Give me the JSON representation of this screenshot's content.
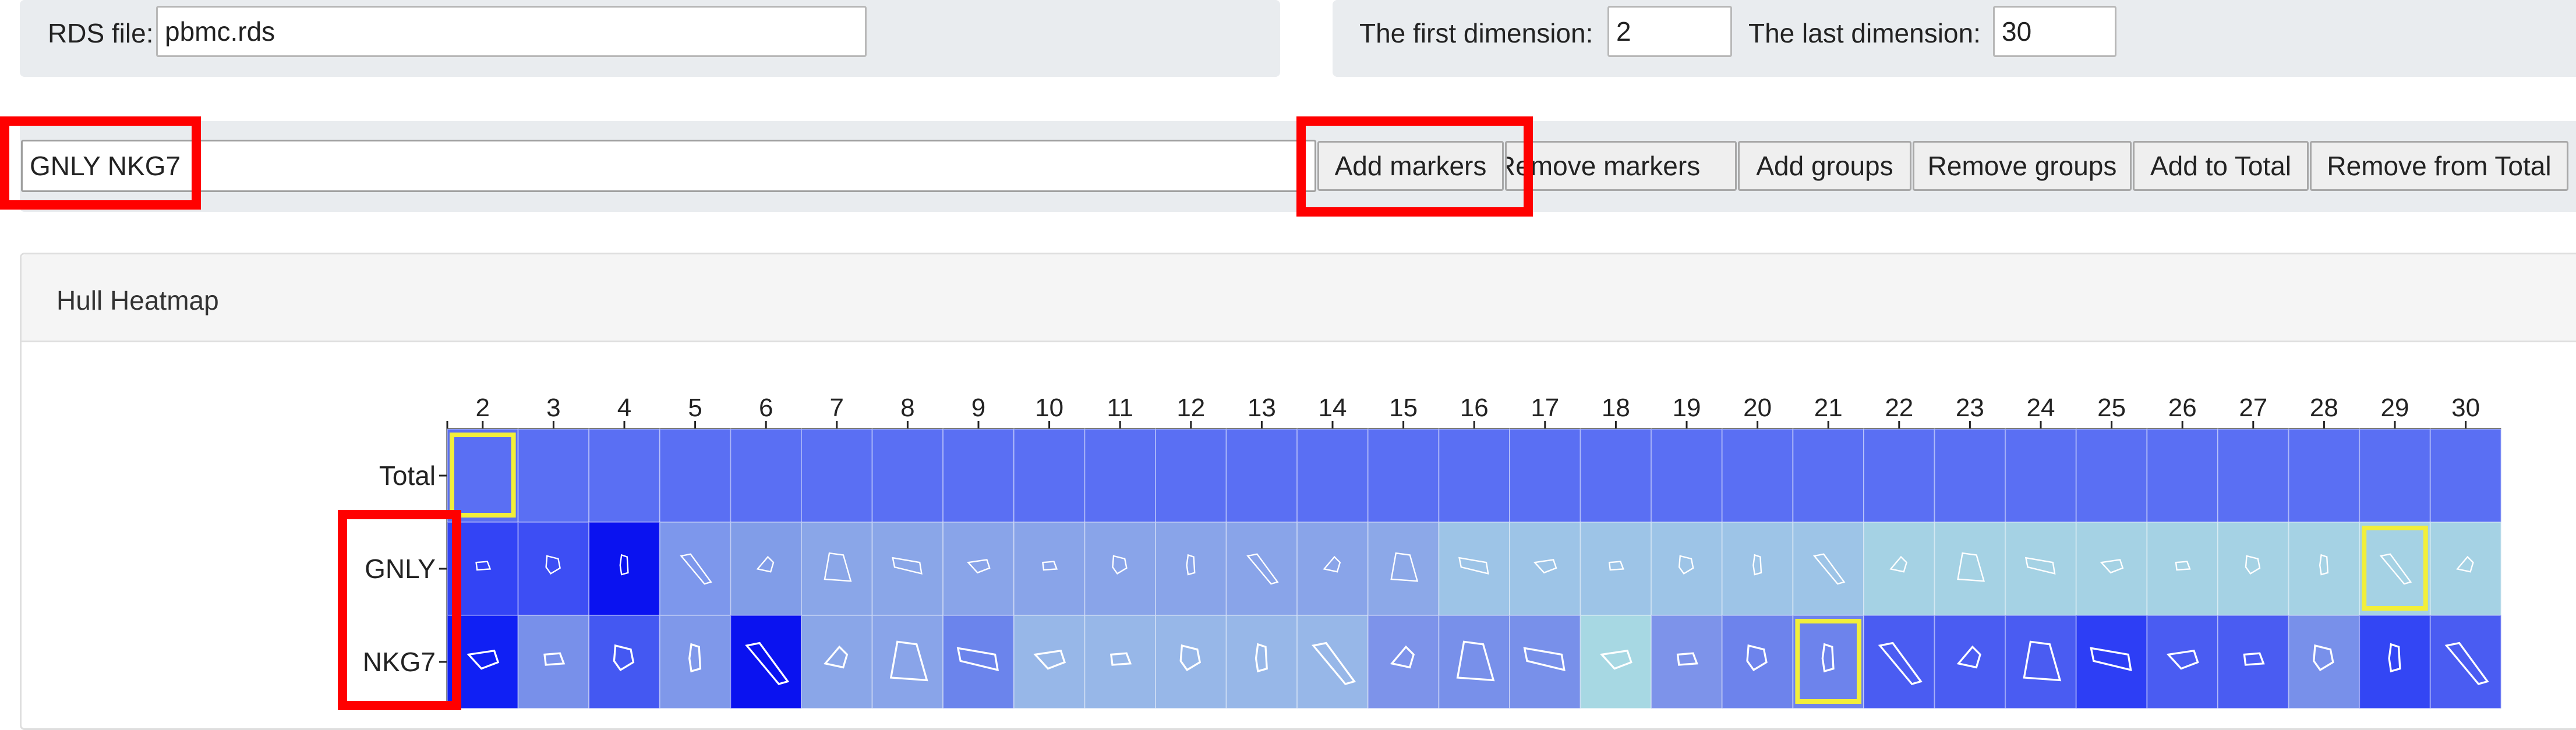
{
  "rds": {
    "label": "RDS file:",
    "value": "pbmc.rds"
  },
  "dims": {
    "first_label": "The first dimension:",
    "first_value": "2",
    "last_label": "The last dimension:",
    "last_value": "30"
  },
  "markers": {
    "input_value": "GNLY NKG7"
  },
  "buttons": {
    "add_markers": "Add markers",
    "remove_markers": "Remove markers",
    "add_groups": "Add groups",
    "remove_groups": "Remove groups",
    "add_total": "Add to Total",
    "remove_total": "Remove from Total"
  },
  "card": {
    "title": "Hull Heatmap"
  },
  "chart_data": {
    "type": "heatmap",
    "title": "",
    "columns": [
      "2",
      "3",
      "4",
      "5",
      "6",
      "7",
      "8",
      "9",
      "10",
      "11",
      "12",
      "13",
      "14",
      "15",
      "16",
      "17",
      "18",
      "19",
      "20",
      "21",
      "22",
      "23",
      "24",
      "25",
      "26",
      "27",
      "28",
      "29",
      "30"
    ],
    "rows": [
      "Total",
      "GNLY",
      "NKG7"
    ],
    "colors": {
      "Total": [
        "#5a6ff3",
        "#5a6ff3",
        "#5a6ff3",
        "#5a6ff3",
        "#5a6ff3",
        "#5a6ff3",
        "#5a6ff3",
        "#5a6ff3",
        "#5a6ff3",
        "#5a6ff3",
        "#5a6ff3",
        "#5a6ff3",
        "#5a6ff3",
        "#5a6ff3",
        "#5a6ff3",
        "#5a6ff3",
        "#5a6ff3",
        "#5a6ff3",
        "#5a6ff3",
        "#5a6ff3",
        "#5a6ff3",
        "#5a6ff3",
        "#5a6ff3",
        "#5a6ff3",
        "#5a6ff3",
        "#5a6ff3",
        "#5a6ff3",
        "#5a6ff3",
        "#5a6ff3"
      ],
      "GNLY": [
        "#3344f5",
        "#3d4ef4",
        "#0a12f0",
        "#7d97ec",
        "#819de8",
        "#8aa6e8",
        "#8aa6e8",
        "#89a4e9",
        "#89a4e9",
        "#89a4e9",
        "#89a4e9",
        "#89a4e9",
        "#89a4e9",
        "#8ca8e8",
        "#9dc4e7",
        "#9dc4e7",
        "#9dc4e7",
        "#9dc4e7",
        "#9dc4e7",
        "#9dc4e7",
        "#a5d2e4",
        "#a5d2e4",
        "#a5d2e4",
        "#a5d2e4",
        "#a5d2e4",
        "#a5d2e4",
        "#a5d2e4",
        "#a5d2e4",
        "#a5d2e4"
      ],
      "NKG7": [
        "#1020f4",
        "#7890ea",
        "#4458f2",
        "#7f98ea",
        "#0a12f0",
        "#8aa6e8",
        "#89a4e9",
        "#6b84ec",
        "#97b7e8",
        "#97b7e8",
        "#97b7e8",
        "#97b7e8",
        "#97b7e8",
        "#7d93ea",
        "#7890ea",
        "#7890ea",
        "#a7d8e3",
        "#7d93ea",
        "#6d83ec",
        "#6d83ec",
        "#4a5cf2",
        "#4a5cf2",
        "#4a5cf2",
        "#2d3ef5",
        "#4a5cf2",
        "#4a5cf2",
        "#7890ea",
        "#3346f4",
        "#4a5cf2"
      ]
    },
    "highlighted_cells": [
      {
        "row": "Total",
        "column": "2"
      },
      {
        "row": "GNLY",
        "column": "29"
      },
      {
        "row": "NKG7",
        "column": "21"
      }
    ]
  }
}
